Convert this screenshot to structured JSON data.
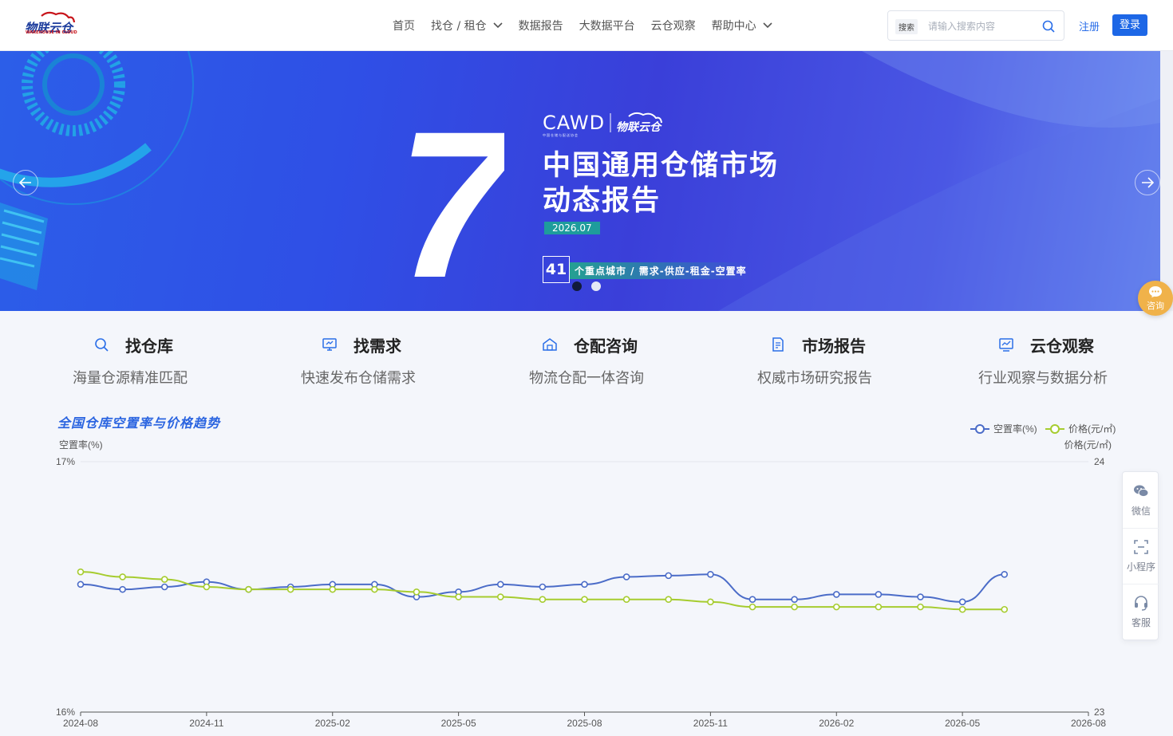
{
  "header": {
    "logo": {
      "alt": "物联云仓",
      "sub": "WAREHOUSE IN CLOUD"
    },
    "nav": [
      {
        "label": "首页",
        "dropdown": false
      },
      {
        "label": "找仓 / 租仓",
        "dropdown": true
      },
      {
        "label": "数据报告",
        "dropdown": false
      },
      {
        "label": "大数据平台",
        "dropdown": false
      },
      {
        "label": "云仓观察",
        "dropdown": false
      },
      {
        "label": "帮助中心",
        "dropdown": true
      }
    ],
    "search": {
      "tag": "搜索",
      "placeholder": "请输入搜索内容"
    },
    "register": "注册",
    "login": "登录"
  },
  "banner": {
    "big_number": "7",
    "brand": "CAWD",
    "brand_sub": "中国仓储与配送协会",
    "title_line1": "中国通用仓储市场",
    "title_line2": "动态报告",
    "date": "2026.07",
    "city_count": "41",
    "city_text": "个重点城市 / 需求-供应-租金-空置率",
    "slides": 2,
    "active_slide": 0
  },
  "float": {
    "consult": "咨询",
    "side": [
      "微信",
      "小程序",
      "客服"
    ]
  },
  "features": [
    {
      "icon": "search-icon",
      "title": "找仓库",
      "desc": "海量仓源精准匹配"
    },
    {
      "icon": "monitor-icon",
      "title": "找需求",
      "desc": "快速发布仓储需求"
    },
    {
      "icon": "warehouse-icon",
      "title": "仓配咨询",
      "desc": "物流仓配一体咨询"
    },
    {
      "icon": "report-icon",
      "title": "市场报告",
      "desc": "权威市场研究报告"
    },
    {
      "icon": "chart-icon",
      "title": "云仓观察",
      "desc": "行业观察与数据分析"
    }
  ],
  "chart_title": "全国仓库空置率与价格趋势",
  "colors": {
    "primary": "#1d67e6",
    "vacancy": "#4b6cc8",
    "price": "#a6cc2f"
  },
  "chart_data": {
    "type": "line",
    "title": "全国仓库空置率与价格趋势",
    "x": [
      "2024-08",
      "2024-09",
      "2024-10",
      "2024-11",
      "2024-12",
      "2025-01",
      "2025-02",
      "2025-03",
      "2025-04",
      "2025-05",
      "2025-06",
      "2025-07",
      "2025-08",
      "2025-09",
      "2025-10",
      "2025-11",
      "2025-12",
      "2026-01",
      "2026-02",
      "2026-03",
      "2026-04",
      "2026-05",
      "2026-06"
    ],
    "x_ticks": [
      "2024-08",
      "2024-11",
      "2025-02",
      "2025-05",
      "2025-08",
      "2025-11",
      "2026-02",
      "2026-05",
      "2026-08"
    ],
    "series": [
      {
        "name": "空置率(%)",
        "axis": "left",
        "values": [
          16.51,
          16.49,
          16.5,
          16.52,
          16.49,
          16.5,
          16.51,
          16.51,
          16.46,
          16.48,
          16.51,
          16.5,
          16.51,
          16.54,
          16.545,
          16.55,
          16.45,
          16.45,
          16.47,
          16.47,
          16.46,
          16.44,
          16.55
        ]
      },
      {
        "name": "价格(元/㎡)",
        "axis": "right",
        "values": [
          23.56,
          23.54,
          23.53,
          23.5,
          23.49,
          23.49,
          23.49,
          23.49,
          23.48,
          23.46,
          23.46,
          23.45,
          23.45,
          23.45,
          23.45,
          23.44,
          23.42,
          23.42,
          23.42,
          23.42,
          23.42,
          23.41,
          23.41
        ]
      }
    ],
    "ylabel_left": "空置率(%)",
    "ylabel_right": "价格(元/㎡)",
    "ylim_left": [
      16,
      17
    ],
    "ylim_right": [
      23,
      24
    ],
    "left_tick_labels": [
      "16%",
      "17%"
    ],
    "right_tick_labels": [
      "23",
      "24"
    ],
    "legend": "top-right",
    "grid": true
  }
}
